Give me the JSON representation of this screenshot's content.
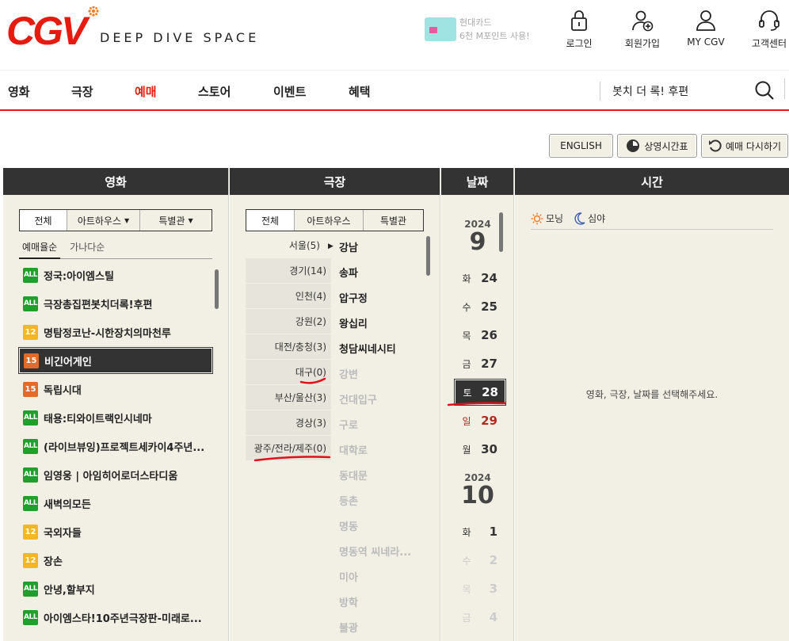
{
  "header": {
    "logo_text": "CGV",
    "tagline": "DEEP DIVE SPACE",
    "promo": {
      "line1": "현대카드",
      "line2": "6천 M포인트 사용!"
    },
    "utilities": [
      {
        "label": "로그인",
        "icon": "lock-icon"
      },
      {
        "label": "회원가입",
        "icon": "add-user-icon"
      },
      {
        "label": "MY CGV",
        "icon": "user-icon"
      },
      {
        "label": "고객센터",
        "icon": "headset-icon"
      }
    ]
  },
  "nav": {
    "items": [
      "영화",
      "극장",
      "예매",
      "스토어",
      "이벤트",
      "혜택"
    ],
    "active": "예매",
    "search_text": "봇치 더 록! 후편"
  },
  "toolbar": {
    "english": "ENGLISH",
    "schedule": "상영시간표",
    "restart": "예매 다시하기"
  },
  "movie_col": {
    "title": "영화",
    "tabs": [
      "전체",
      "아트하우스",
      "특별관"
    ],
    "sort": [
      "예매율순",
      "가나다순"
    ],
    "movies": [
      {
        "rating": "ALL",
        "title": "정국:아이엠스틸"
      },
      {
        "rating": "ALL",
        "title": "극장총집편봇치더록!후편"
      },
      {
        "rating": "12",
        "title": "명탐정코난-시한장치의마천루"
      },
      {
        "rating": "15",
        "title": "비긴어게인",
        "selected": true
      },
      {
        "rating": "15",
        "title": "독립시대"
      },
      {
        "rating": "ALL",
        "title": "태용:티와이트랙인시네마"
      },
      {
        "rating": "ALL",
        "title": "(라이브뷰잉)프로젝트세카이4주년..."
      },
      {
        "rating": "ALL",
        "title": "임영웅 | 아임히어로더스타디움"
      },
      {
        "rating": "ALL",
        "title": "새벽의모든"
      },
      {
        "rating": "12",
        "title": "국외자들"
      },
      {
        "rating": "12",
        "title": "장손"
      },
      {
        "rating": "ALL",
        "title": "안녕,할부지"
      },
      {
        "rating": "ALL",
        "title": "아이엠스타!10주년극장판-미래로..."
      }
    ]
  },
  "theater_col": {
    "title": "극장",
    "tabs": [
      "전체",
      "아트하우스",
      "특별관"
    ],
    "regions": [
      "서울(5)",
      "경기(14)",
      "인천(4)",
      "강원(2)",
      "대전/충청(3)",
      "대구(0)",
      "부산/울산(3)",
      "경상(3)",
      "광주/전라/제주(0)"
    ],
    "theaters": [
      {
        "name": "강남",
        "enabled": true
      },
      {
        "name": "송파",
        "enabled": true
      },
      {
        "name": "압구정",
        "enabled": true
      },
      {
        "name": "왕십리",
        "enabled": true
      },
      {
        "name": "청담씨네시티",
        "enabled": true
      },
      {
        "name": "강변",
        "enabled": false
      },
      {
        "name": "건대입구",
        "enabled": false
      },
      {
        "name": "구로",
        "enabled": false
      },
      {
        "name": "대학로",
        "enabled": false
      },
      {
        "name": "동대문",
        "enabled": false
      },
      {
        "name": "등촌",
        "enabled": false
      },
      {
        "name": "명동",
        "enabled": false
      },
      {
        "name": "명동역 씨네라...",
        "enabled": false
      },
      {
        "name": "미아",
        "enabled": false
      },
      {
        "name": "방학",
        "enabled": false
      },
      {
        "name": "불광",
        "enabled": false
      }
    ]
  },
  "date_col": {
    "title": "날짜",
    "groups": [
      {
        "year": "2024",
        "month": "9",
        "days": [
          {
            "dow": "화",
            "day": "24",
            "state": "normal"
          },
          {
            "dow": "수",
            "day": "25",
            "state": "normal"
          },
          {
            "dow": "목",
            "day": "26",
            "state": "normal"
          },
          {
            "dow": "금",
            "day": "27",
            "state": "normal"
          },
          {
            "dow": "토",
            "day": "28",
            "state": "selected"
          },
          {
            "dow": "일",
            "day": "29",
            "state": "sunday"
          },
          {
            "dow": "월",
            "day": "30",
            "state": "normal"
          }
        ]
      },
      {
        "year": "2024",
        "month": "10",
        "days": [
          {
            "dow": "화",
            "day": "1",
            "state": "normal"
          },
          {
            "dow": "수",
            "day": "2",
            "state": "disabled"
          },
          {
            "dow": "목",
            "day": "3",
            "state": "disabled"
          },
          {
            "dow": "금",
            "day": "4",
            "state": "disabled"
          }
        ]
      }
    ]
  },
  "time_col": {
    "title": "시간",
    "filters": [
      {
        "label": "모닝",
        "icon": "sun-icon"
      },
      {
        "label": "심야",
        "icon": "moon-icon"
      }
    ],
    "message": "영화, 극장, 날짜를 선택해주세요."
  },
  "colors": {
    "brand_red": "#e71a0f",
    "panel_bg": "#f2f0e5",
    "header_dark": "#333333",
    "rating_all": "#1f9f2c",
    "rating_12": "#f4b625",
    "rating_15": "#e36b2a"
  }
}
